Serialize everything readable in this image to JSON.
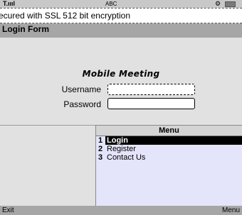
{
  "status_bar": {
    "signal": "T.ıııl",
    "input_mode": "ABC",
    "settings_icon": "gear-icon",
    "battery_icon": "battery-icon"
  },
  "ticker": {
    "text": "ecured with SSL 512 bit encryption"
  },
  "title_bar": {
    "title": "Login Form"
  },
  "form": {
    "app_title": "Mobile Meeting",
    "username_label": "Username",
    "username_value": "",
    "password_label": "Password",
    "password_value": ""
  },
  "menu": {
    "title": "Menu",
    "items": [
      {
        "number": "1",
        "label": "Login",
        "selected": true
      },
      {
        "number": "2",
        "label": "Register",
        "selected": false
      },
      {
        "number": "3",
        "label": "Contact Us",
        "selected": false
      }
    ]
  },
  "softkeys": {
    "left": "Exit",
    "right": "Menu"
  },
  "colors": {
    "menu_background": "#e4e4fb",
    "selection": "#000000",
    "title_bar": "#a6a6a6"
  }
}
